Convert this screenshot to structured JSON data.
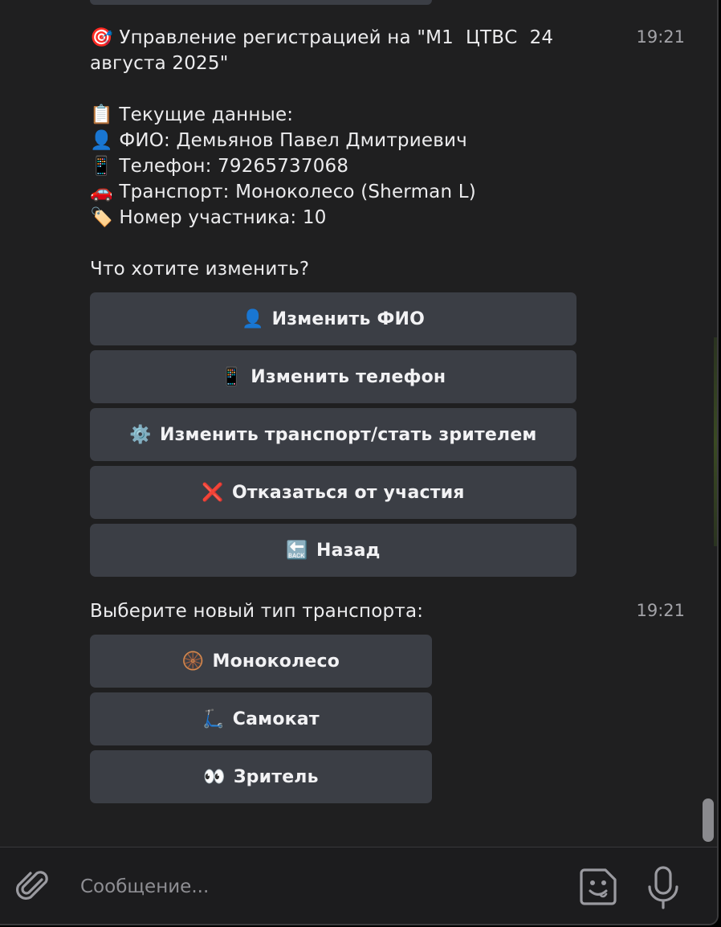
{
  "messages": {
    "m1": {
      "lines": [
        "🎯 Управление регистрацией на \"М1  ЦТВС  24",
        "августа 2025\"",
        "",
        "📋 Текущие данные:",
        "👤 ФИО: Демьянов Павел Дмитриевич",
        "📱 Телефон: 79265737068",
        "🚗 Транспорт: Моноколесо (Sherman L)",
        "🏷️ Номер участника: 10",
        "",
        "Что хотите изменить?"
      ],
      "time": "19:21",
      "buttons": [
        {
          "icon": "👤",
          "label": "Изменить ФИО"
        },
        {
          "icon": "📱",
          "label": "Изменить телефон"
        },
        {
          "icon": "⚙️",
          "label": "Изменить транспорт/стать зрителем"
        },
        {
          "icon": "❌",
          "label": "Отказаться от участия"
        },
        {
          "icon": "🔙",
          "label": "Назад"
        }
      ]
    },
    "m2": {
      "text": "Выберите новый тип транспорта:",
      "time": "19:21",
      "buttons": [
        {
          "icon": "🛞",
          "label": "Моноколесо"
        },
        {
          "icon": "🛴",
          "label": "Самокат"
        },
        {
          "icon": "👀",
          "label": "Зритель"
        }
      ]
    }
  },
  "composer": {
    "placeholder": "Сообщение...",
    "icons": [
      "paperclip-icon",
      "sticker-icon",
      "microphone-icon"
    ]
  },
  "colors": {
    "background": "#1f1f20",
    "button": "#3b3e45",
    "text": "#ececee",
    "muted": "#a3a3a8"
  }
}
